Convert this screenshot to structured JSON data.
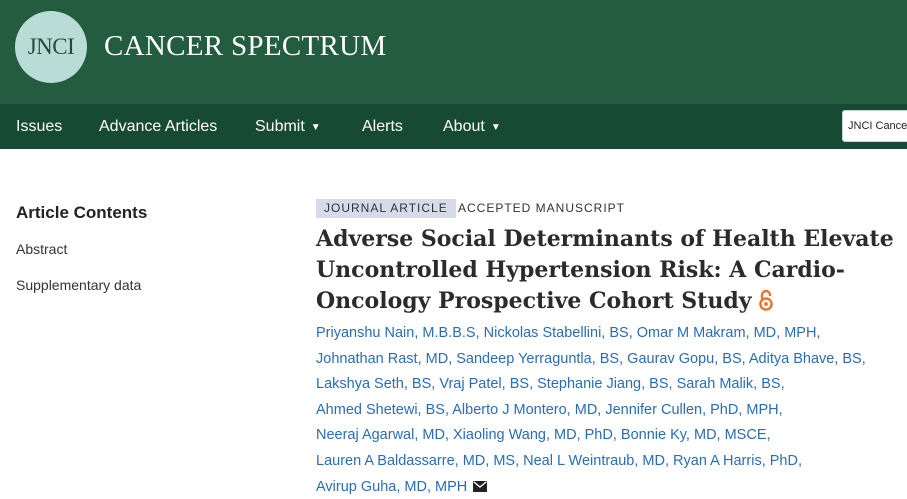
{
  "header": {
    "logo_text": "JNCI",
    "brand": "CANCER SPECTRUM"
  },
  "nav": {
    "items": [
      {
        "label": "Issues",
        "dropdown": false
      },
      {
        "label": "Advance Articles",
        "dropdown": false
      },
      {
        "label": "Submit",
        "dropdown": true
      },
      {
        "label": "Alerts",
        "dropdown": false
      },
      {
        "label": "About",
        "dropdown": true
      }
    ],
    "search_scope": "JNCI Cancer Spectrum"
  },
  "sidebar": {
    "title": "Article Contents",
    "links": [
      "Abstract",
      "Supplementary data"
    ]
  },
  "article": {
    "type_badge": "JOURNAL ARTICLE",
    "status_badge": "ACCEPTED MANUSCRIPT",
    "title": "Adverse Social Determinants of Health Elevate Uncontrolled Hypertension Risk: A Cardio-Oncology Prospective Cohort Study",
    "open_access_icon": "open-access-lock-icon",
    "corresponding_icon": "envelope-icon",
    "authors": [
      "Priyanshu Nain, M.B.B.S",
      "Nickolas Stabellini, BS",
      "Omar M Makram, MD, MPH",
      "Johnathan Rast, MD",
      "Sandeep Yerraguntla, BS",
      "Gaurav Gopu, BS",
      "Aditya Bhave, BS",
      "Lakshya Seth, BS",
      "Vraj Patel, BS",
      "Stephanie Jiang, BS",
      "Sarah Malik, BS",
      "Ahmed Shetewi, BS",
      "Alberto J Montero, MD",
      "Jennifer Cullen, PhD, MPH",
      "Neeraj Agarwal, MD",
      "Xiaoling Wang, MD, PhD",
      "Bonnie Ky, MD, MSCE",
      "Lauren A Baldassarre, MD, MS",
      "Neal L Weintraub, MD",
      "Ryan A Harris, PhD",
      "Avirup Guha, MD, MPH"
    ]
  },
  "colors": {
    "header_bg": "#235c3f",
    "nav_bg": "#174a33",
    "logo_circle": "#b9ddd6",
    "author_link": "#2a6db5",
    "open_access": "#e8742a"
  }
}
